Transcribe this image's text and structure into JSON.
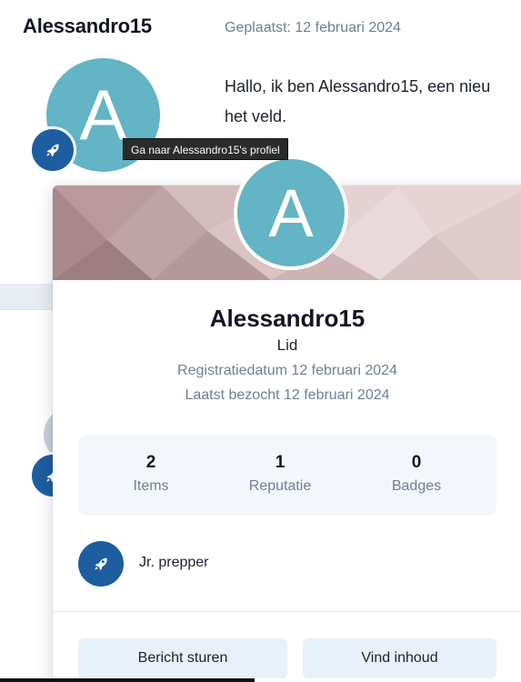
{
  "post": {
    "author": "Alessandro15",
    "date_label": "Geplaatst: 12 februari 2024",
    "body_line1": "Hallo, ik ben Alessandro15, een nieu",
    "body_line2": "het veld.",
    "avatar_letter": "A"
  },
  "tooltip": {
    "text": "Ga naar Alessandro15's profiel"
  },
  "profile_card": {
    "avatar_letter": "A",
    "name": "Alessandro15",
    "role": "Lid",
    "registration": "Registratiedatum 12 februari 2024",
    "last_visit": "Laatst bezocht 12 februari 2024",
    "stats": [
      {
        "value": "2",
        "label": "Items"
      },
      {
        "value": "1",
        "label": "Reputatie"
      },
      {
        "value": "0",
        "label": "Badges"
      }
    ],
    "rank": {
      "label": "Jr. prepper",
      "icon": "rocket-icon"
    },
    "buttons": {
      "message": "Bericht sturen",
      "find_content": "Vind inhoud"
    }
  },
  "colors": {
    "avatar": "#63b4c4",
    "rank_badge": "#1e5da0",
    "button_bg": "#e8f1fa",
    "muted_text": "#6f7f97"
  }
}
